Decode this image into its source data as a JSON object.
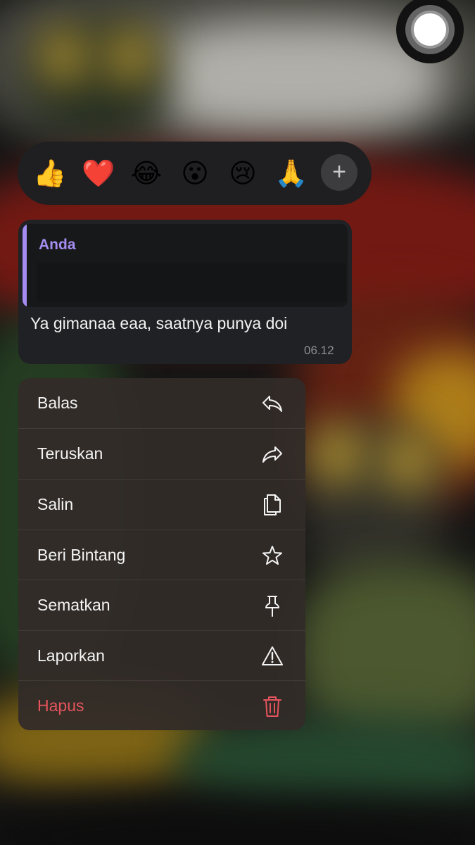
{
  "reactions": {
    "emojis": [
      "👍",
      "❤️",
      "😂",
      "😮",
      "😢",
      "🙏"
    ],
    "more_label": "+"
  },
  "message": {
    "quote_author": "Anda",
    "text": "Ya gimanaa eaa, saatnya punya doi",
    "time": "06.12"
  },
  "menu": {
    "items": [
      {
        "label": "Balas",
        "icon": "reply-icon"
      },
      {
        "label": "Teruskan",
        "icon": "forward-icon"
      },
      {
        "label": "Salin",
        "icon": "copy-icon"
      },
      {
        "label": "Beri Bintang",
        "icon": "star-icon"
      },
      {
        "label": "Sematkan",
        "icon": "pin-icon"
      },
      {
        "label": "Laporkan",
        "icon": "warning-icon"
      },
      {
        "label": "Hapus",
        "icon": "trash-icon"
      }
    ]
  },
  "colors": {
    "accent_quote": "#a48cf0",
    "danger": "#e5545d"
  }
}
